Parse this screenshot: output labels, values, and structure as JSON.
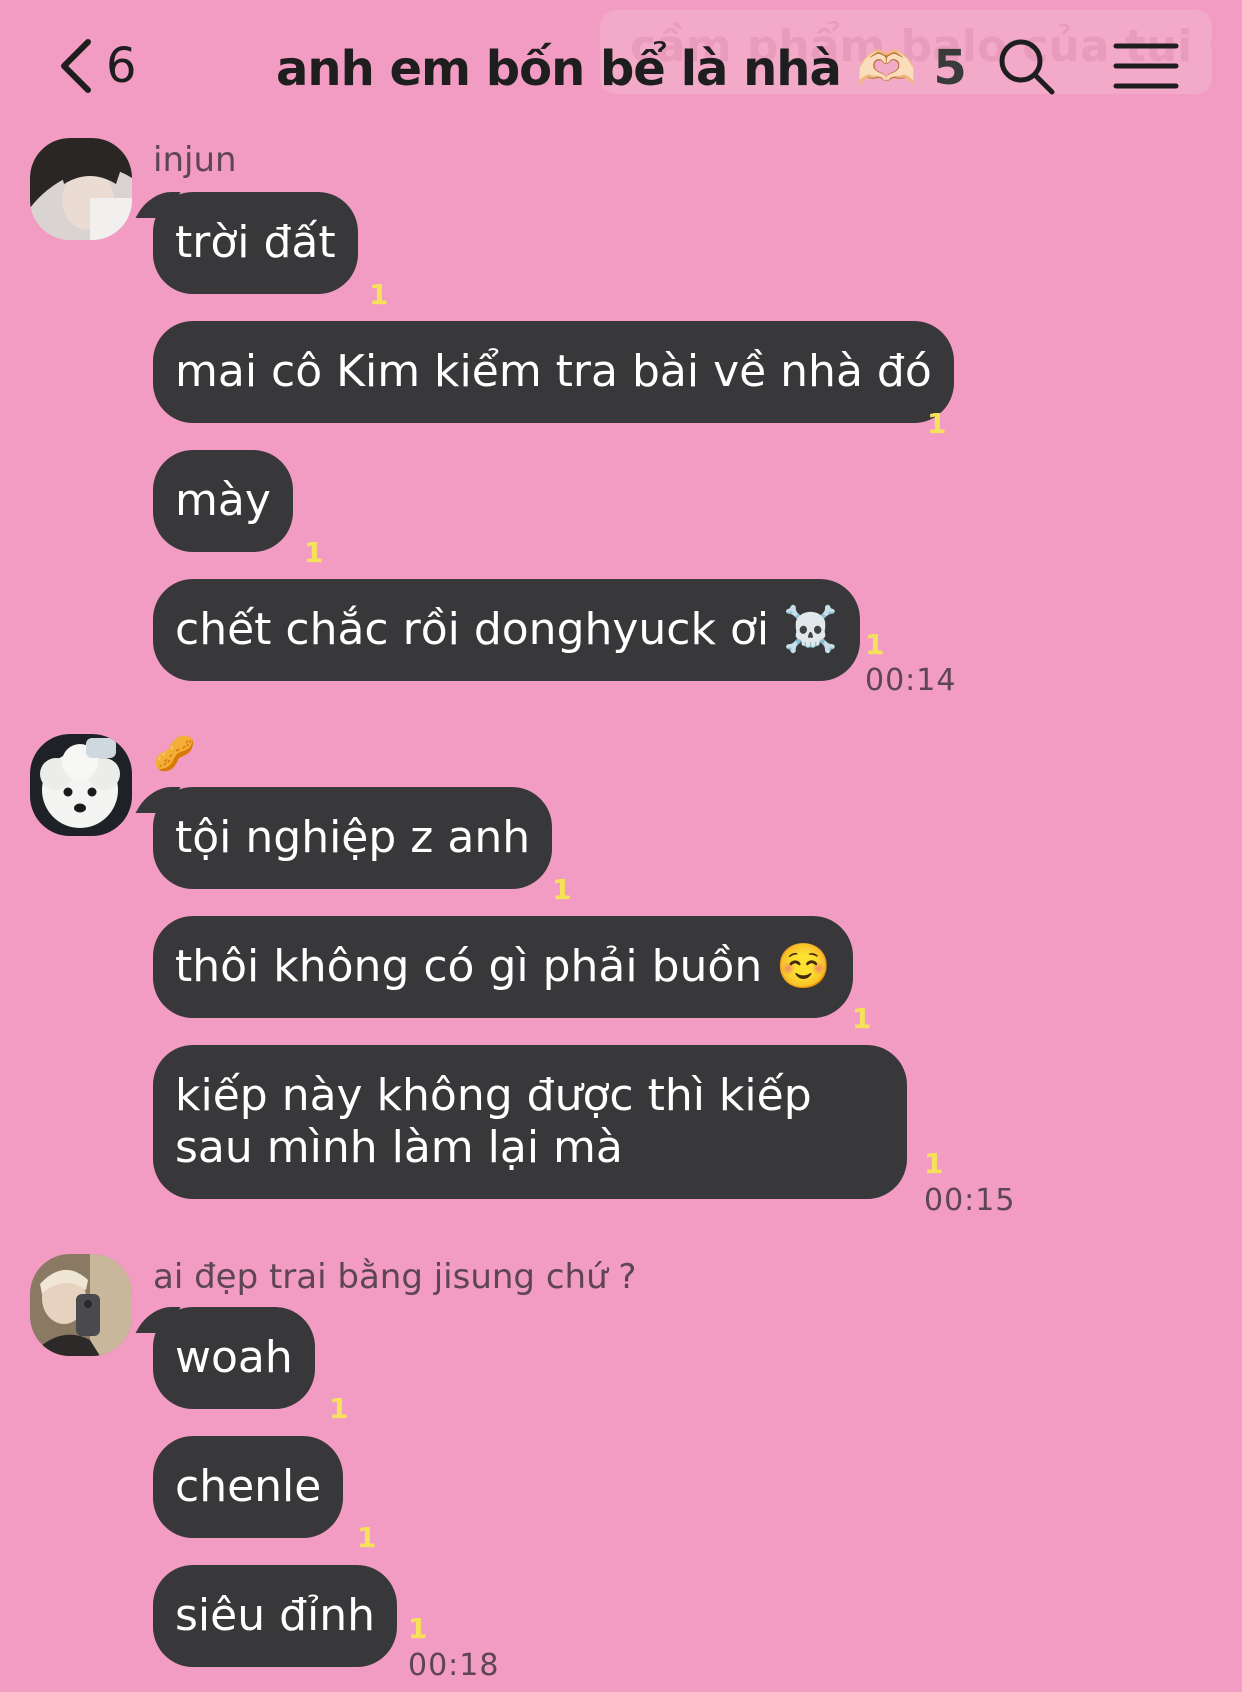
{
  "header": {
    "back_count": "6",
    "title": "anh em bốn bể là nhà 🫶🏻",
    "member_count": "5",
    "ghost_text": "cầm phẩm balo của tui 🥺"
  },
  "groups": [
    {
      "sender": "injun",
      "avatar_icon": "avatar-photo",
      "messages": [
        {
          "text": "trời đất",
          "read": "1"
        },
        {
          "text": "mai cô Kim kiểm tra bài về nhà đó",
          "read": "1"
        },
        {
          "text": "mày",
          "read": "1"
        },
        {
          "text": "chết chắc rồi donghyuck ơi ☠️",
          "read": "1"
        }
      ],
      "time": "00:14"
    },
    {
      "sender": "🥜",
      "avatar_icon": "white-dog-avatar",
      "messages": [
        {
          "text": "tội nghiệp z anh",
          "read": "1"
        },
        {
          "text": "thôi không có gì phải buồn ☺️",
          "read": "1"
        },
        {
          "text": "kiếp này không được thì kiếp sau mình làm lại mà",
          "read": "1"
        }
      ],
      "time": "00:15"
    },
    {
      "sender": "ai đẹp trai bằng jisung chứ ?",
      "avatar_icon": "mirror-selfie-avatar",
      "messages": [
        {
          "text": "woah",
          "read": "1"
        },
        {
          "text": "chenle",
          "read": "1"
        },
        {
          "text": "siêu đỉnh",
          "read": "1"
        }
      ],
      "time": "00:18"
    }
  ],
  "colors": {
    "background": "#f29cc4",
    "bubble": "#38383b",
    "read_count": "#f6e15b",
    "meta_text": "#5d4652"
  }
}
